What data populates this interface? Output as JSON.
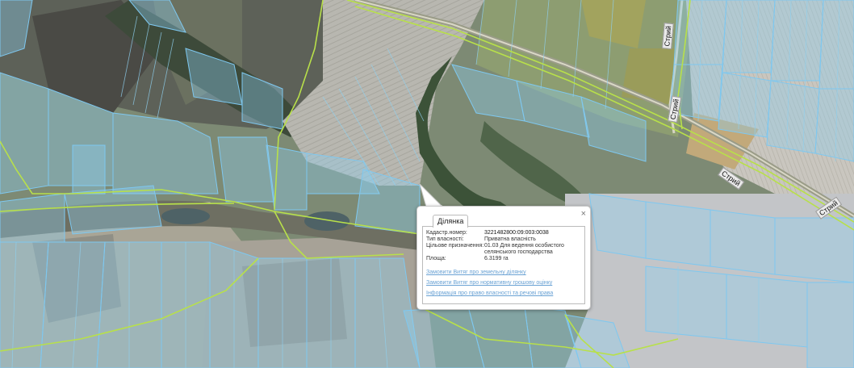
{
  "map": {
    "road_labels": [
      "Стрий",
      "Стрий",
      "Стрий",
      "Стрий"
    ]
  },
  "popup": {
    "tab_label": "Ділянка",
    "close_label": "×",
    "rows": [
      {
        "key": "Кадастр.номер:",
        "value": "3221482800:09:003:0038"
      },
      {
        "key": "Тип власності:",
        "value": "Приватна власність"
      },
      {
        "key": "Цільове призначення:",
        "value": "01.03 Для ведення особистого селянського господарства"
      },
      {
        "key": "Площа:",
        "value": "6.3199 га"
      }
    ],
    "links": [
      "Замовити Витяг про земельну ділянку",
      "Замовити Витяг про нормативну грошову оцінку",
      "Інформація про право власності та речові права"
    ]
  },
  "colors": {
    "parcel_fill": "#8fd0ee",
    "parcel_stroke": "#7ec8f0",
    "boundary": "#b8e04a",
    "link": "#6aa2d4"
  }
}
